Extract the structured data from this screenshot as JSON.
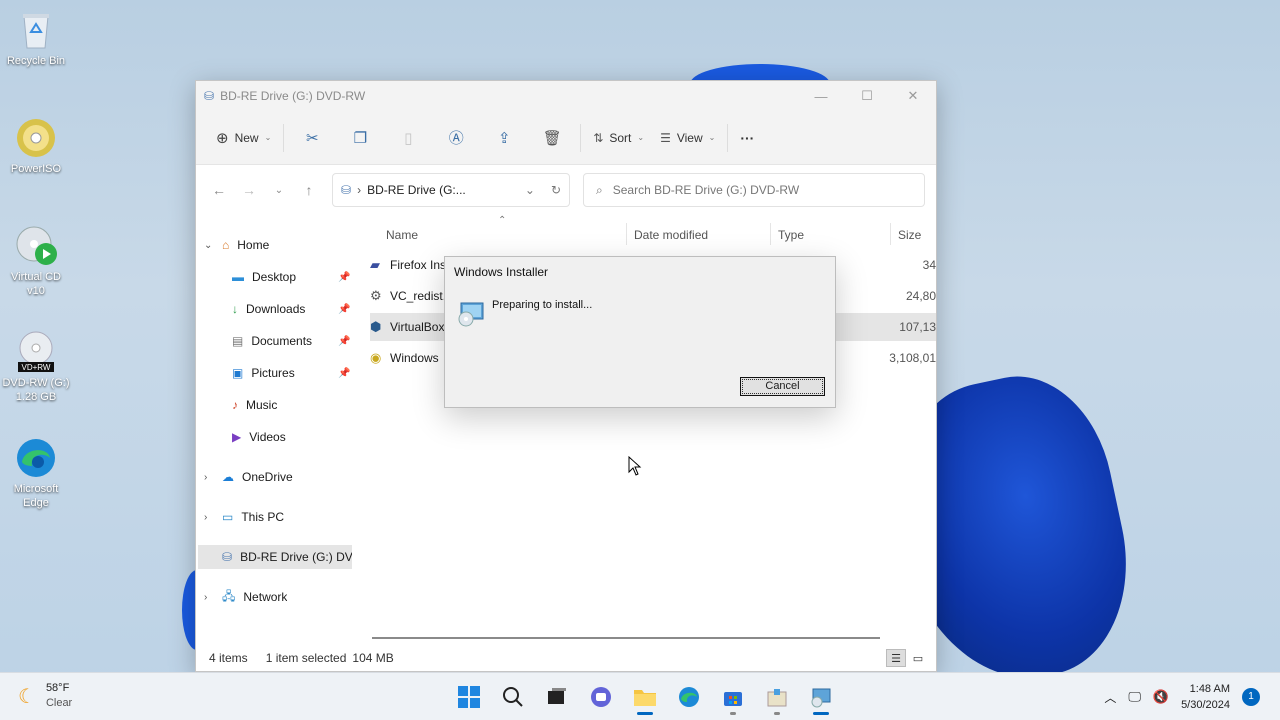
{
  "desktop": {
    "icons": [
      {
        "label": "Recycle Bin"
      },
      {
        "label": "PowerISO"
      },
      {
        "label": "Virtual CD v10"
      },
      {
        "label": "DVD-RW (G:) 1.28 GB",
        "badge": "VD+RW"
      },
      {
        "label": "Microsoft Edge"
      }
    ]
  },
  "explorer": {
    "title": "BD-RE Drive (G:) DVD-RW",
    "toolbar": {
      "new_label": "New",
      "sort_label": "Sort",
      "view_label": "View",
      "more_label": "···"
    },
    "address": {
      "path": "BD-RE Drive (G:...",
      "search_placeholder": "Search BD-RE Drive (G:) DVD-RW"
    },
    "nav": {
      "home": "Home",
      "quick": [
        "Desktop",
        "Downloads",
        "Documents",
        "Pictures",
        "Music",
        "Videos"
      ],
      "onedrive": "OneDrive",
      "thispc": "This PC",
      "drive": "BD-RE Drive (G:) DVD",
      "network": "Network"
    },
    "columns": {
      "name": "Name",
      "date": "Date modified",
      "type": "Type",
      "size": "Size"
    },
    "files": [
      {
        "name": "Firefox Ins",
        "type": "",
        "size": "34"
      },
      {
        "name": "VC_redist.",
        "type": "",
        "size": "24,80"
      },
      {
        "name": "VirtualBox",
        "type": "",
        "size": "107,13"
      },
      {
        "name": "Windows",
        "type": "ile",
        "size": "3,108,01"
      }
    ],
    "status": {
      "items": "4 items",
      "selected": "1 item selected",
      "size": "104 MB"
    }
  },
  "installer": {
    "title": "Windows Installer",
    "message": "Preparing to install...",
    "cancel_label": "Cancel"
  },
  "taskbar": {
    "weather_temp": "58°F",
    "weather_cond": "Clear",
    "time": "1:48 AM",
    "date": "5/30/2024",
    "notification_count": "1"
  }
}
